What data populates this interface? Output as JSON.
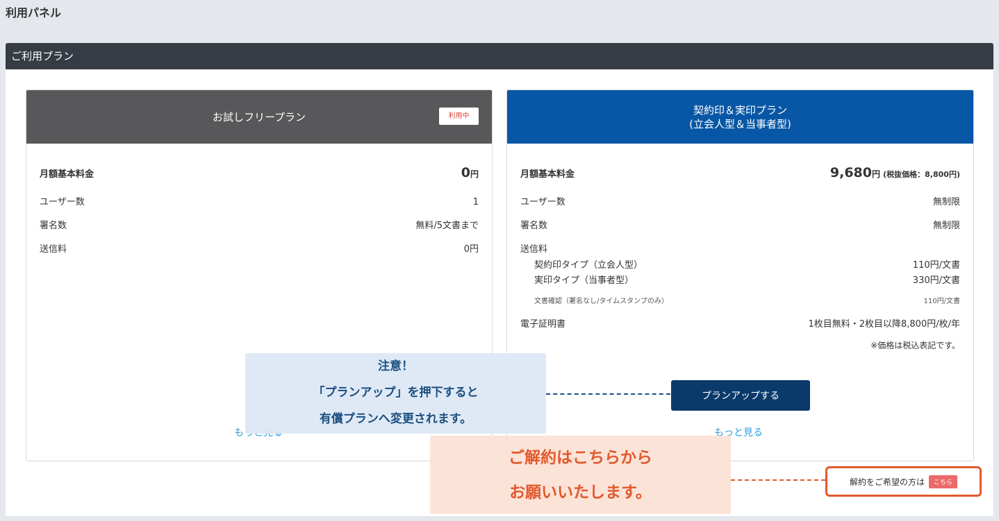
{
  "page_title": "利用パネル",
  "panel_header": "ご利用プラン",
  "free_plan": {
    "name": "お試しフリープラン",
    "badge": "利用中",
    "monthly_fee_label": "月額基本料金",
    "monthly_fee_value": "0",
    "monthly_fee_unit": "円",
    "users_label": "ユーザー数",
    "users_value": "1",
    "signatures_label": "署名数",
    "signatures_value": "無料/5文書まで",
    "sending_fee_label": "送信料",
    "sending_fee_value": "0円",
    "more_link": "もっと見る"
  },
  "paid_plan": {
    "name_line1": "契約印＆実印プラン",
    "name_line2": "(立会人型＆当事者型)",
    "monthly_fee_label": "月額基本料金",
    "monthly_fee_value": "9,680",
    "monthly_fee_unit": "円",
    "monthly_fee_tax_note": "(税抜価格：8,800円)",
    "users_label": "ユーザー数",
    "users_value": "無制限",
    "signatures_label": "署名数",
    "signatures_value": "無制限",
    "sending_fee_label": "送信料",
    "seal_type_label": "契約印タイプ（立会人型）",
    "seal_type_value": "110円/文書",
    "real_seal_label": "実印タイプ（当事者型）",
    "real_seal_value": "330円/文書",
    "doc_confirm_label": "文書確認（署名なし/タイムスタンプのみ）",
    "doc_confirm_value": "110円/文書",
    "cert_label": "電子証明書",
    "cert_value": "1枚目無料・2枚目以降8,800円/枚/年",
    "tax_note": "※価格は税込表記です。",
    "upgrade_button": "プランアップする",
    "more_link": "もっと見る"
  },
  "cancel": {
    "text": "解約をご希望の方は",
    "badge": "こちら"
  },
  "callout_upgrade": {
    "line1": "注意！",
    "line2": "「プランアップ」を押下すると",
    "line3": "有償プランへ変更されます。"
  },
  "callout_cancel": {
    "line1": "ご解約はこちらから",
    "line2": "お願いいたします。"
  },
  "colors": {
    "panel_header_bg": "#363c44",
    "free_plan_header_bg": "#58585a",
    "paid_plan_header_bg": "#0857a6",
    "upgrade_button_bg": "#0a3a6a",
    "link": "#2c9ce0",
    "cancel_accent": "#e2592c"
  }
}
